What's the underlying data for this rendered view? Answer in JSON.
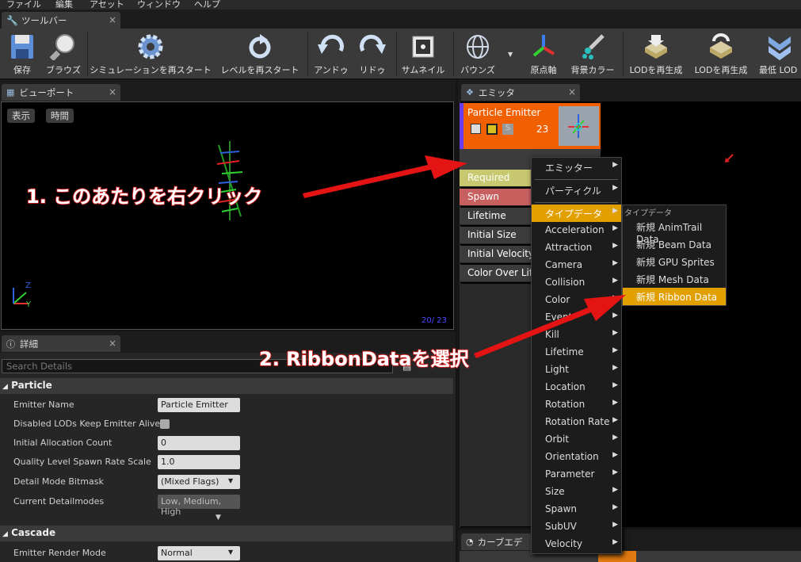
{
  "menubar": {
    "items": [
      "ファイル",
      "編集",
      "アセット",
      "ウィンドウ",
      "ヘルプ"
    ]
  },
  "tabs": {
    "toolbar": "ツールバー",
    "viewport": "ビューポート",
    "emitter": "エミッタ",
    "details": "詳細",
    "curve": "カーブエデ"
  },
  "toolbar": {
    "buttons": [
      {
        "label": "保存",
        "icon": "save-icon"
      },
      {
        "label": "ブラウズ",
        "icon": "browse-icon"
      },
      {
        "label": "シミュレーションを再スタート",
        "icon": "gear-icon"
      },
      {
        "label": "レベルを再スタート",
        "icon": "restart-icon"
      },
      {
        "label": "アンドゥ",
        "icon": "undo-icon"
      },
      {
        "label": "リドゥ",
        "icon": "redo-icon"
      },
      {
        "label": "サムネイル",
        "icon": "thumbnail-icon"
      },
      {
        "label": "バウンズ",
        "icon": "bounds-icon"
      },
      {
        "label": "原点軸",
        "icon": "origin-axis-icon"
      },
      {
        "label": "背景カラー",
        "icon": "background-color-icon"
      },
      {
        "label": "LODを再生成",
        "icon": "regen-lod-icon"
      },
      {
        "label": "LODを再生成",
        "icon": "regen-lod-icon"
      },
      {
        "label": "最低 LOD",
        "icon": "lowest-lod-icon"
      }
    ]
  },
  "viewport": {
    "show_btn": "表示",
    "time_btn": "時間",
    "counter": "20/ 23",
    "axis_z": "Z",
    "axis_y": "Y"
  },
  "details": {
    "search_placeholder": "Search Details",
    "particle_section": "Particle",
    "cascade_section": "Cascade",
    "rows": [
      {
        "name": "Emitter Name",
        "value": "Particle Emitter"
      },
      {
        "name": "Disabled LODs Keep Emitter Alive",
        "value": ""
      },
      {
        "name": "Initial Allocation Count",
        "value": "0"
      },
      {
        "name": "Quality Level Spawn Rate Scale",
        "value": "1.0"
      },
      {
        "name": "Detail Mode Bitmask",
        "value": "(Mixed Flags)"
      },
      {
        "name": "Current Detailmodes",
        "value": "Low, Medium, High"
      }
    ],
    "render_mode_name": "Emitter Render Mode",
    "render_mode_value": "Normal"
  },
  "emitter": {
    "title": "Particle Emitter",
    "count": "23",
    "s_badge": "S",
    "modules": [
      "Required",
      "Spawn",
      "Lifetime",
      "Initial Size",
      "Initial Velocity",
      "Color Over Lif"
    ]
  },
  "context_menu": {
    "items": [
      "エミッター",
      "パーティクル",
      "タイプデータ",
      "Acceleration",
      "Attraction",
      "Camera",
      "Collision",
      "Color",
      "Event",
      "Kill",
      "Lifetime",
      "Light",
      "Location",
      "Rotation",
      "Rotation Rate",
      "Orbit",
      "Orientation",
      "Parameter",
      "Size",
      "Spawn",
      "SubUV",
      "Velocity"
    ],
    "arrow": "▶"
  },
  "submenu": {
    "header": "タイプデータ",
    "items": [
      "新規 AnimTrail Data",
      "新規 Beam Data",
      "新規 GPU Sprites",
      "新規 Mesh Data",
      "新規 Ribbon Data"
    ]
  },
  "annotations": {
    "step1": "1. このあたりを右クリック",
    "step2": "2. RibbonDataを選択"
  },
  "colors": {
    "highlight": "#e1a000",
    "emitter_header": "#f06000",
    "annotation": "#e02020"
  }
}
